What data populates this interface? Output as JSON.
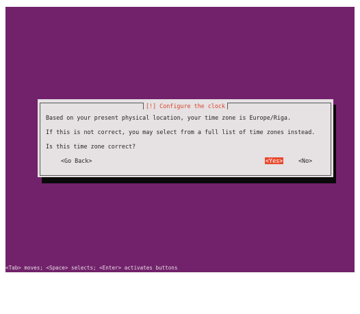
{
  "dialog": {
    "title": "[!] Configure the clock",
    "line1": "Based on your present physical location, your time zone is Europe/Riga.",
    "line2": "If this is not correct, you may select from a full list of time zones instead.",
    "question": "Is this time zone correct?",
    "go_back_label": "<Go Back>",
    "yes_label": "<Yes>",
    "no_label": "<No>"
  },
  "status_bar": "<Tab> moves; <Space> selects; <Enter> activates buttons",
  "colors": {
    "background": "#72226b",
    "dialog": "#e6e1e3",
    "title": "#d8452b",
    "selected_button": "#e8492e"
  }
}
